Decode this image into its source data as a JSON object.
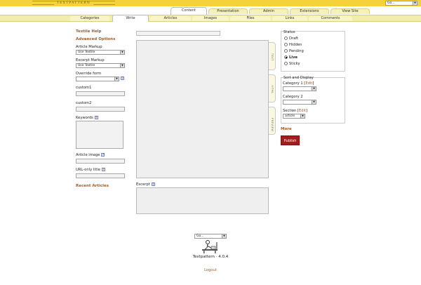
{
  "header": {
    "logo_text": "TEXTPATTERN",
    "jump_select": "Go..."
  },
  "primary_tabs": [
    {
      "label": "Content",
      "active": true
    },
    {
      "label": "Presentation",
      "active": false
    },
    {
      "label": "Admin",
      "active": false
    },
    {
      "label": "Extensions",
      "active": false
    },
    {
      "label": "View Site",
      "active": false
    }
  ],
  "secondary_tabs": [
    {
      "label": "Categories",
      "active": false
    },
    {
      "label": "Write",
      "active": true
    },
    {
      "label": "Articles",
      "active": false
    },
    {
      "label": "Images",
      "active": false
    },
    {
      "label": "Files",
      "active": false
    },
    {
      "label": "Links",
      "active": false
    },
    {
      "label": "Comments",
      "active": false
    }
  ],
  "left": {
    "textile_help": "Textile Help",
    "advanced_options": "Advanced Options",
    "article_markup_label": "Article Markup",
    "article_markup_value": "Use Textile",
    "excerpt_markup_label": "Excerpt Markup",
    "excerpt_markup_value": "Use Textile",
    "override_form_label": "Override form",
    "custom1_label": "custom1",
    "custom2_label": "custom2",
    "keywords_label": "Keywords",
    "article_image_label": "Article image",
    "url_only_title_label": "URL-only title",
    "recent_articles": "Recent Articles",
    "help_glyph": "?"
  },
  "center": {
    "side_tabs": [
      "TEXT",
      "HTML",
      "PREVIEW"
    ],
    "excerpt_label": "Excerpt"
  },
  "right": {
    "status_label": "Status",
    "statuses": [
      {
        "label": "Draft",
        "checked": false
      },
      {
        "label": "Hidden",
        "checked": false
      },
      {
        "label": "Pending",
        "checked": false
      },
      {
        "label": "Live",
        "checked": true
      },
      {
        "label": "Sticky",
        "checked": false
      }
    ],
    "sort_display_label": "Sort and Display",
    "category1_label": "Category 1",
    "category2_label": "Category 2",
    "section_label": "Section",
    "section_value": "article",
    "edit_link": "Edit",
    "more_label": "More",
    "publish_label": "Publish"
  },
  "footer": {
    "jump_select": "Go...",
    "version": "Textpattern · 4.0.4",
    "logout": "Logout"
  },
  "colors": {
    "accent_yellow": "#f5d13a",
    "link_brown": "#a05c27",
    "publish_red": "#a21d1d"
  }
}
